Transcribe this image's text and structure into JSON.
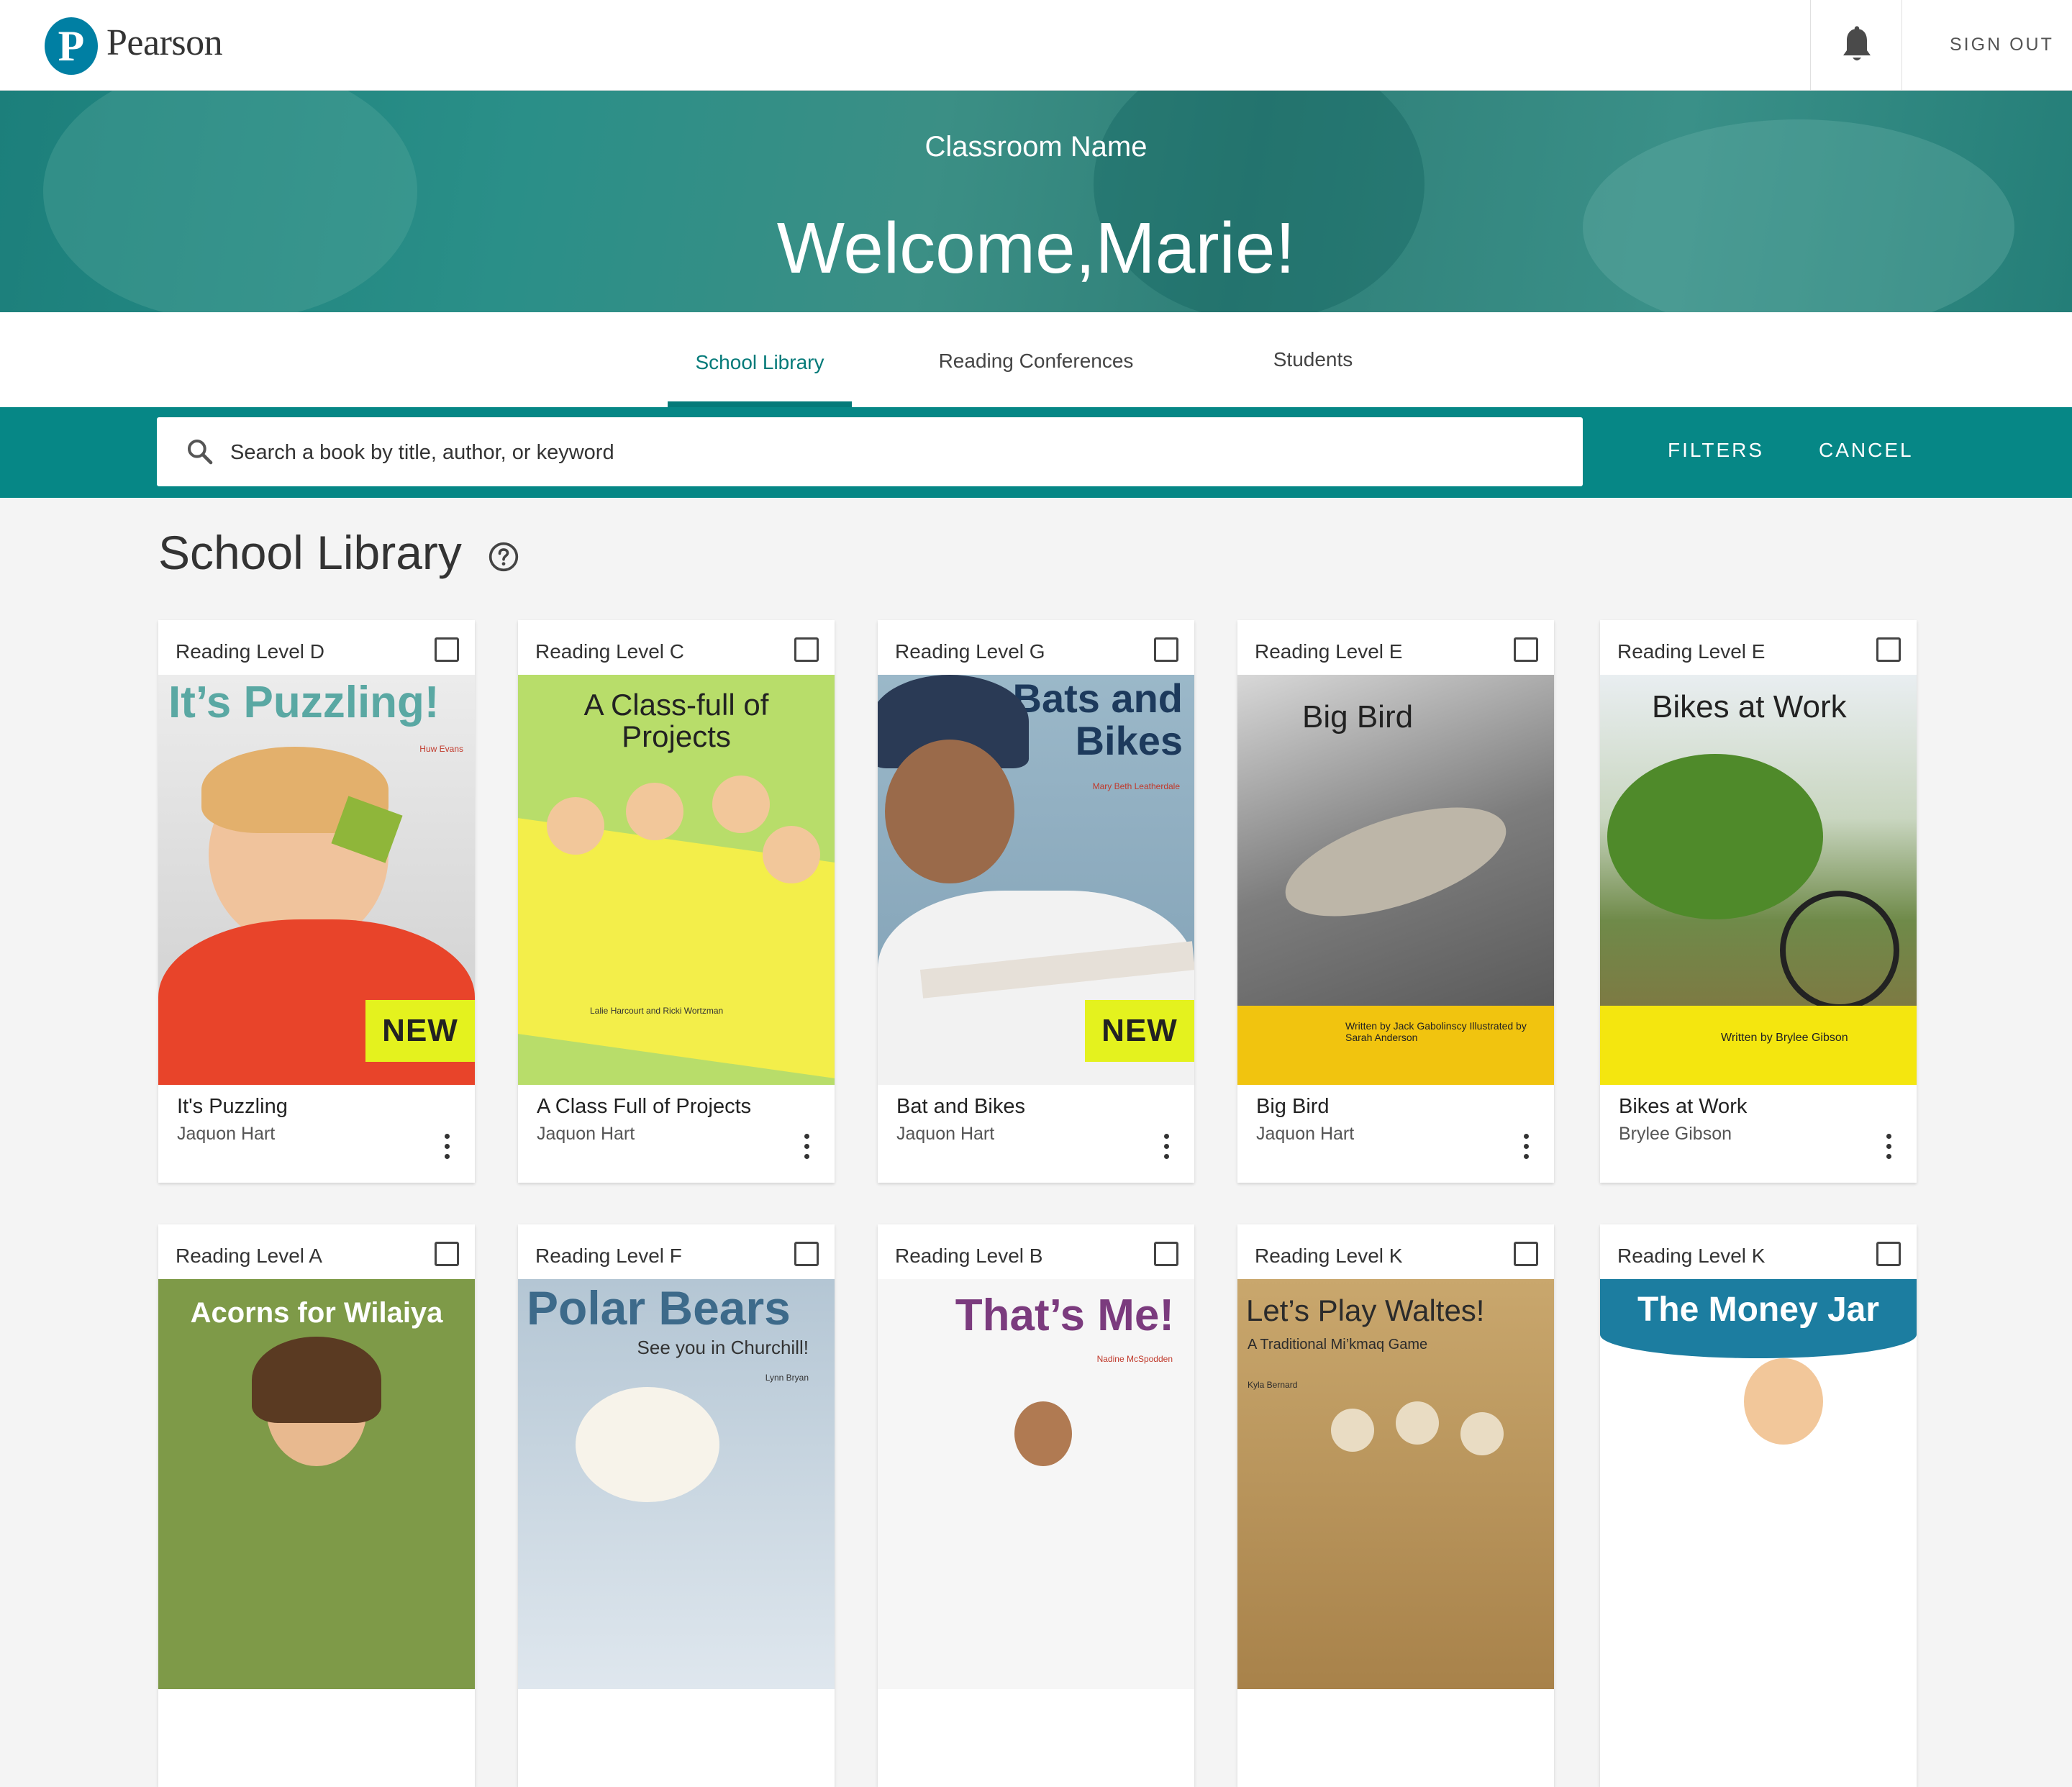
{
  "header": {
    "brand": "Pearson",
    "logo_letter": "P",
    "sign_out": "SIGN OUT"
  },
  "hero": {
    "classroom_name": "Classroom Name",
    "welcome": "Welcome,Marie!"
  },
  "tabs": [
    {
      "label": "School Library"
    },
    {
      "label": "Reading Conferences"
    },
    {
      "label": "Students"
    }
  ],
  "search": {
    "placeholder": "Search a book by title, author, or keyword",
    "filters": "FILTERS",
    "cancel": "CANCEL"
  },
  "section": {
    "title": "School Library"
  },
  "books": [
    {
      "level": "Reading Level  D",
      "title": "It's Puzzling",
      "author": "Jaquon Hart",
      "cover_title": "It’s Puzzling!",
      "cover_author": "Huw Evans",
      "badge": "NEW"
    },
    {
      "level": "Reading Level  C",
      "title": "A Class Full of Projects",
      "author": "Jaquon Hart",
      "cover_title": "A Class-full of Projects",
      "cover_author": "Lalie Harcourt and Ricki Wortzman"
    },
    {
      "level": "Reading Level  G",
      "title": "Bat and Bikes",
      "author": "Jaquon Hart",
      "cover_title": "Bats and Bikes",
      "cover_author": "Mary Beth Leatherdale",
      "badge": "NEW"
    },
    {
      "level": "Reading Level  E",
      "title": "Big Bird",
      "author": "Jaquon Hart",
      "cover_title": "Big Bird",
      "cover_author": "Written by Jack Gabolinscy Illustrated by Sarah Anderson"
    },
    {
      "level": "Reading Level  E",
      "title": "Bikes at Work",
      "author": "Brylee Gibson",
      "cover_title": "Bikes at Work",
      "cover_author": "Written by Brylee Gibson"
    },
    {
      "level": "Reading Level  A",
      "cover_title": "Acorns for Wilaiya"
    },
    {
      "level": "Reading Level  F",
      "cover_title": "Polar Bears",
      "cover_sub": "See you in Churchill!",
      "cover_author": "Lynn Bryan"
    },
    {
      "level": "Reading Level  B",
      "cover_title": "That’s Me!",
      "cover_author": "Nadine McSpodden"
    },
    {
      "level": "Reading Level  K",
      "cover_title": "Let’s Play Waltes!",
      "cover_sub": "A Traditional Mi’kmaq Game",
      "cover_author": "Kyla Bernard"
    },
    {
      "level": "Reading Level  K",
      "cover_title": "The Money Jar"
    }
  ],
  "colors": {
    "teal_primary": "#068786",
    "teal_tab": "#047a79",
    "new_badge": "#e4f21e",
    "pearson_blue": "#007fa3"
  },
  "icons": [
    "bell-icon",
    "search-icon",
    "help-icon",
    "more-vert-icon",
    "checkbox-icon"
  ]
}
